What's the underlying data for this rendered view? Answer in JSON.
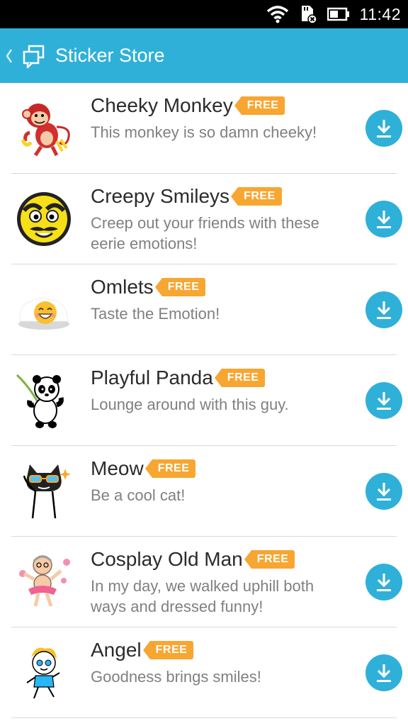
{
  "status_bar": {
    "time": "11:42"
  },
  "app_bar": {
    "title": "Sticker Store"
  },
  "colors": {
    "accent": "#2fb0d9",
    "badge": "#f7a631"
  },
  "stickers": [
    {
      "title": "Cheeky Monkey",
      "badge": "FREE",
      "description": "This monkey is so damn cheeky!",
      "icon": "monkey-icon"
    },
    {
      "title": "Creepy Smileys",
      "badge": "FREE",
      "description": "Creep out your friends with these eerie emotions!",
      "icon": "smiley-icon"
    },
    {
      "title": "Omlets",
      "badge": "FREE",
      "description": "Taste the Emotion!",
      "icon": "omlet-icon"
    },
    {
      "title": "Playful Panda",
      "badge": "FREE",
      "description": "Lounge around with this guy.",
      "icon": "panda-icon"
    },
    {
      "title": "Meow",
      "badge": "FREE",
      "description": "Be a cool cat!",
      "icon": "cat-icon"
    },
    {
      "title": "Cosplay Old Man",
      "badge": "FREE",
      "description": "In my day, we walked uphill both ways and dressed funny!",
      "icon": "old-man-icon"
    },
    {
      "title": "Angel",
      "badge": "FREE",
      "description": "Goodness brings smiles!",
      "icon": "angel-icon"
    }
  ]
}
